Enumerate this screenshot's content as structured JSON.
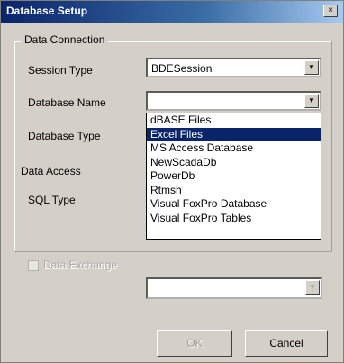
{
  "window": {
    "title": "Database Setup",
    "close_glyph": "×"
  },
  "group": {
    "title": "Data Connection"
  },
  "session_type": {
    "label": "Session Type",
    "value": "BDESession"
  },
  "database_name": {
    "label": "Database Name",
    "value": ""
  },
  "database_type": {
    "label": "Database Type"
  },
  "data_access": {
    "label": "Data Access"
  },
  "sql_type": {
    "label": "SQL Type"
  },
  "dropdown_options": [
    "dBASE Files",
    "Excel Files",
    "MS Access Database",
    "NewScadaDb",
    "PowerDb",
    "Rtmsh",
    "Visual FoxPro Database",
    "Visual FoxPro Tables"
  ],
  "selected_option": "Excel Files",
  "checkbox": {
    "label": "Data Exchange",
    "checked": false,
    "enabled": false
  },
  "lower_combo": {
    "value": ""
  },
  "buttons": {
    "ok": "OK",
    "cancel": "Cancel"
  },
  "colors": {
    "titlebar": "#0a246a",
    "selection": "#0a246a",
    "face": "#d4d0c8"
  },
  "icons": {
    "dropdown": "chevron-down-icon",
    "close": "close-icon"
  }
}
